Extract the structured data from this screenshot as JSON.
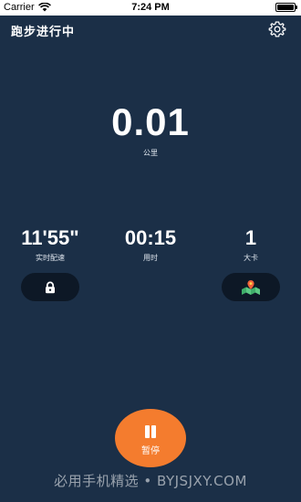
{
  "status_bar": {
    "carrier": "Carrier",
    "time": "7:24 PM"
  },
  "header": {
    "title": "跑步进行中",
    "settings_icon": "gear-icon"
  },
  "distance": {
    "value": "0.01",
    "unit": "公里"
  },
  "stats": [
    {
      "value": "11'55\"",
      "label": "实时配速"
    },
    {
      "value": "00:15",
      "label": "用时"
    },
    {
      "value": "1",
      "label": "大卡"
    }
  ],
  "controls": {
    "lock_icon": "lock-icon",
    "map_icon": "map-icon"
  },
  "pause": {
    "label": "暂停",
    "color": "#f47c2e"
  },
  "watermark": "必用手机精选 • BYJSJXY.COM",
  "colors": {
    "background": "#1b2f47",
    "accent": "#f47c2e",
    "pill": "#0d1826"
  }
}
